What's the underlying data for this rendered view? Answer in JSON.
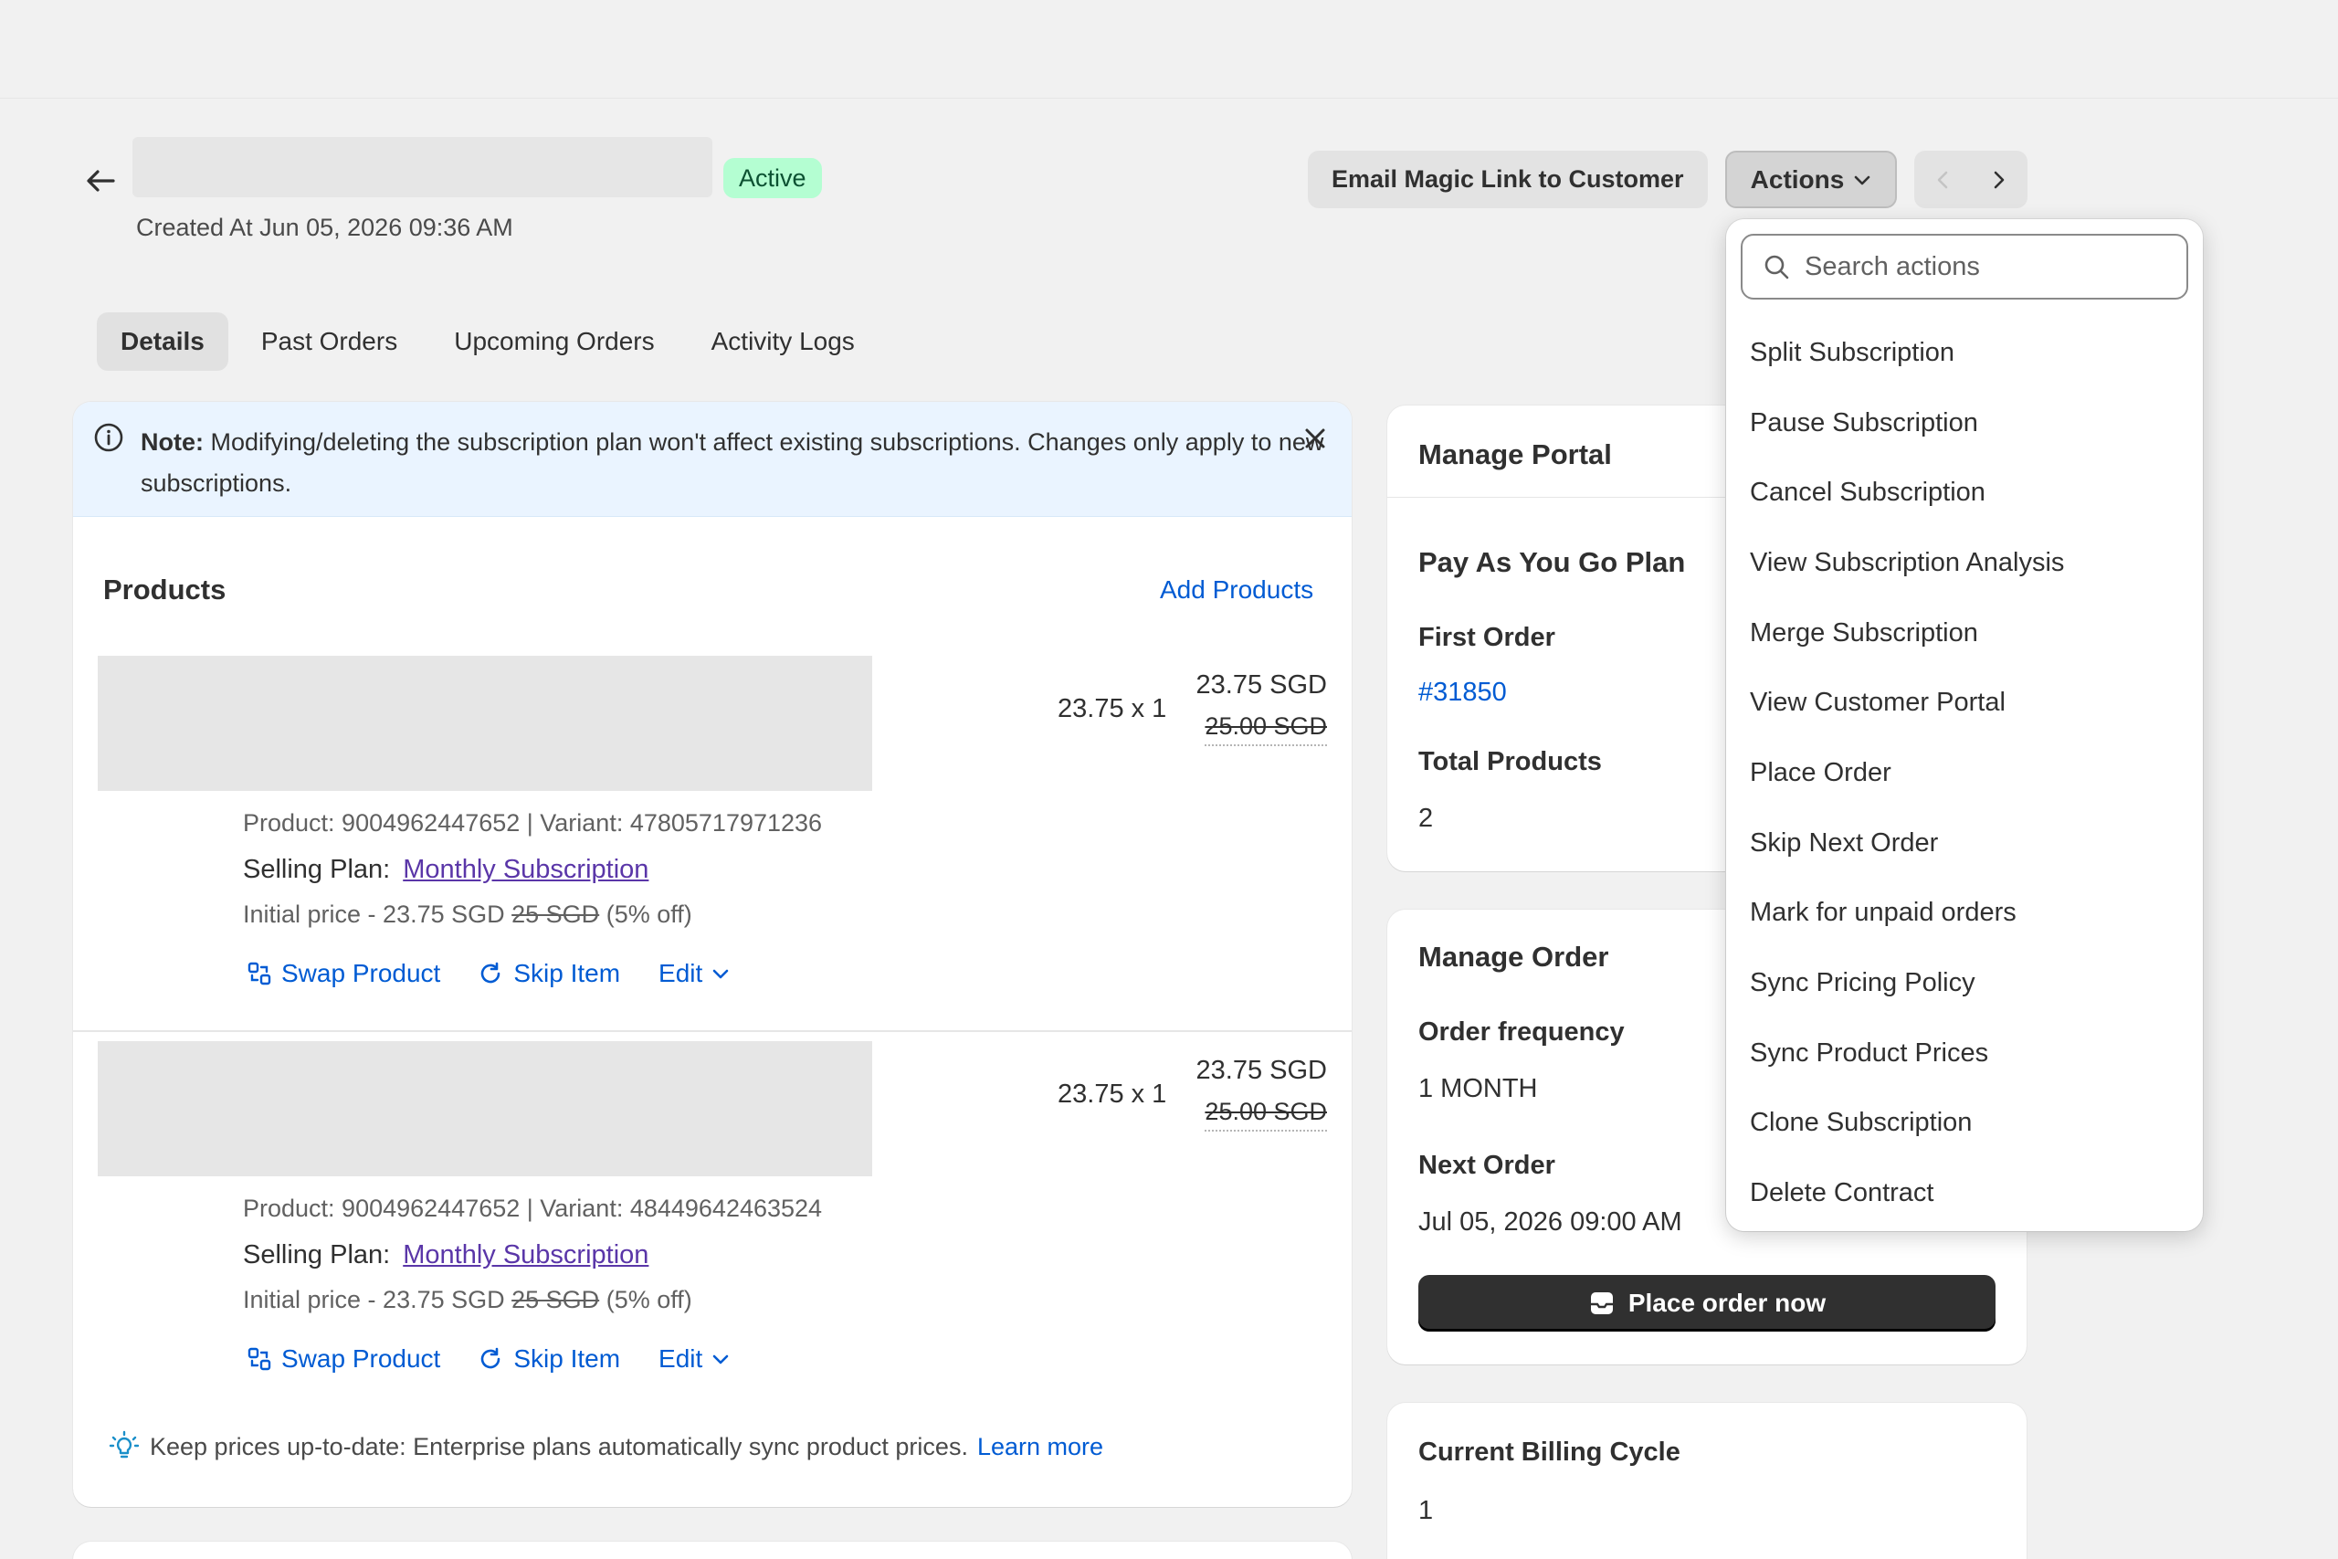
{
  "header": {
    "status_badge": "Active",
    "created_at": "Created At Jun 05, 2026 09:36 AM",
    "email_button": "Email Magic Link to Customer",
    "actions_button": "Actions"
  },
  "tabs": [
    {
      "label": "Details",
      "active": true
    },
    {
      "label": "Past Orders",
      "active": false
    },
    {
      "label": "Upcoming Orders",
      "active": false
    },
    {
      "label": "Activity Logs",
      "active": false
    }
  ],
  "note_banner": {
    "prefix": "Note:",
    "text": " Modifying/deleting the subscription plan won't affect existing subscriptions. Changes only apply to new subscriptions."
  },
  "products": {
    "title": "Products",
    "add_link": "Add Products",
    "items": [
      {
        "quantity_text": "23.75 x 1",
        "price": "23.75 SGD",
        "original_price": "25.00 SGD",
        "ids": "Product: 9004962447652 | Variant: 47805717971236",
        "selling_plan_label": "Selling Plan:",
        "selling_plan": "Monthly Subscription",
        "initial_prefix": "Initial price - 23.75 SGD",
        "initial_struck": "25 SGD",
        "initial_suffix": "(5% off)",
        "swap_label": "Swap Product",
        "skip_label": "Skip Item",
        "edit_label": "Edit"
      },
      {
        "quantity_text": "23.75 x 1",
        "price": "23.75 SGD",
        "original_price": "25.00 SGD",
        "ids": "Product: 9004962447652 | Variant: 48449642463524",
        "selling_plan_label": "Selling Plan:",
        "selling_plan": "Monthly Subscription",
        "initial_prefix": "Initial price - 23.75 SGD",
        "initial_struck": "25 SGD",
        "initial_suffix": "(5% off)",
        "swap_label": "Swap Product",
        "skip_label": "Skip Item",
        "edit_label": "Edit"
      }
    ],
    "tip_text": "Keep prices up-to-date: Enterprise plans automatically sync product prices.",
    "tip_link": "Learn more"
  },
  "portal": {
    "title": "Manage Portal",
    "plan_title": "Pay As You Go Plan",
    "first_order_label": "First Order",
    "first_order_value": "#31850",
    "total_products_label": "Total Products",
    "total_products_value": "2"
  },
  "manage_order": {
    "title": "Manage Order",
    "frequency_label": "Order frequency",
    "frequency_value": "1 MONTH",
    "next_order_label": "Next Order",
    "next_order_value": "Jul 05, 2026 09:00 AM",
    "place_order_button": "Place order now"
  },
  "billing": {
    "title": "Current Billing Cycle",
    "value": "1"
  },
  "actions_menu": {
    "search_placeholder": "Search actions",
    "items": [
      "Split Subscription",
      "Pause Subscription",
      "Cancel Subscription",
      "View Subscription Analysis",
      "Merge Subscription",
      "View Customer Portal",
      "Place Order",
      "Skip Next Order",
      "Mark for unpaid orders",
      "Sync Pricing Policy",
      "Sync Product Prices",
      "Clone Subscription",
      "Delete Contract"
    ]
  },
  "colors": {
    "link": "#005bd3",
    "active_badge_bg": "#b4fed2",
    "banner_bg": "#eaf4ff",
    "primary_button": "#303030"
  },
  "icons": [
    "arrow-left-icon",
    "chevron-down-icon",
    "chevron-left-icon",
    "chevron-right-icon",
    "info-icon",
    "close-icon",
    "swap-icon",
    "skip-icon",
    "lightbulb-icon",
    "search-icon",
    "inbox-icon"
  ]
}
